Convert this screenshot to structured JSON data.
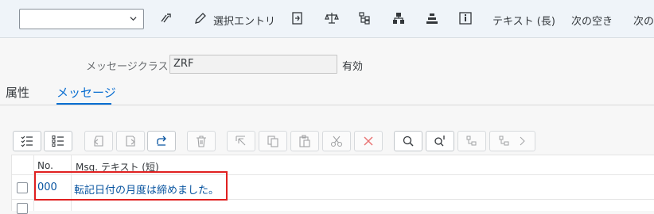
{
  "toolbar": {
    "dropdown_value": "",
    "select_entry_label": "選択エントリ",
    "text_long_label": "テキスト (長)",
    "next_free_label": "次の空き",
    "next_partial_label": "次の"
  },
  "header": {
    "message_class_label": "メッセージクラス:",
    "message_class_value": "ZRF",
    "status": "有効"
  },
  "tabs": [
    {
      "label": "属性",
      "active": false
    },
    {
      "label": "メッセージ",
      "active": true
    }
  ],
  "table": {
    "columns": [
      "No.",
      "Msg. テキスト (短)"
    ],
    "rows": [
      {
        "no": "000",
        "text": "転記日付の月度は締めました。"
      },
      {
        "no": "",
        "text": ""
      }
    ]
  },
  "colors": {
    "accent": "#0a6ed1",
    "link": "#0854a0",
    "highlight_border": "#e02020",
    "toolbar_bg": "#eff4f9"
  },
  "icons": [
    "chevron-down-icon",
    "display-change-icon",
    "pencil-icon",
    "other-object-icon",
    "balance-check-icon",
    "where-used-icon",
    "hierarchy-icon",
    "stack-icon",
    "info-icon",
    "select-all-icon",
    "deselect-all-icon",
    "back-icon",
    "forward-icon",
    "redo-icon",
    "delete-icon",
    "cursor-select-icon",
    "copy-icon",
    "paste-icon",
    "cut-icon",
    "cancel-x-icon",
    "search-icon",
    "search-next-icon",
    "tree-expand-icon",
    "tree-more-icon"
  ]
}
